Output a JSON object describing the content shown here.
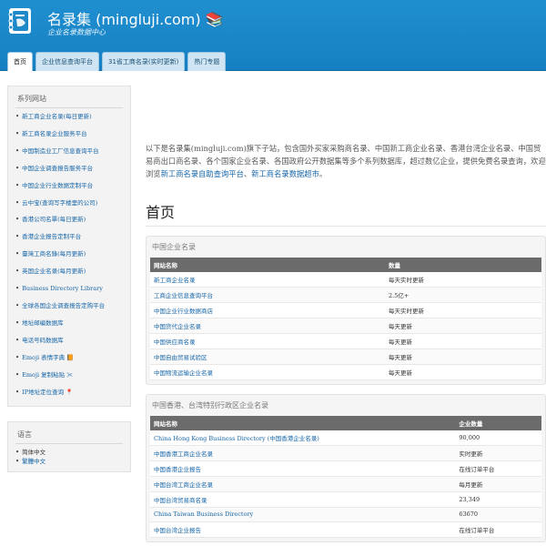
{
  "header": {
    "title": "名录集 (mingluji.com) 📚",
    "subtitle": "企业名录数据中心"
  },
  "nav": {
    "tabs": [
      {
        "label": "首页",
        "active": true
      },
      {
        "label": "企业信息查询平台",
        "active": false
      },
      {
        "label": "31省工商名录(实时更新)",
        "active": false
      },
      {
        "label": "热门专题",
        "active": false
      }
    ]
  },
  "sidebar": {
    "series_title": "系列网站",
    "series_items": [
      "新工商企业名录(每日更新)",
      "新工商名录企业服务平台",
      "中国制造业工厂信息查询平台",
      "中国企业调查报告服务平台",
      "中国企业行业数据定制平台",
      "云中宝(查询写字楼里的公司)",
      "香港公司名單(每日更新)",
      "香港企业报告定制平台",
      "臺灣工商名錄(每月更新)",
      "英国企业名录(每月更新)",
      "Business Directory Library",
      "全球各国企业调查报告定购平台",
      "地址邮编数据库",
      "电话号码数据库",
      "Emoji 表情字典 📙",
      "Emoji 复制粘贴 ✂",
      "IP地址定位查询 📍"
    ],
    "language_title": "语言",
    "languages": [
      {
        "label": "简体中文",
        "link": false
      },
      {
        "label": "繁體中文",
        "link": true
      }
    ]
  },
  "main": {
    "intro_text": "以下是名录集(mingluji.com)旗下子站，包含国外买家采购商名录、中国新工商企业名录、香港台湾企业名录、中国贸易商出口商名录、各个国家企业名录、各国政府公开数据集等多个系列数据库，超过数亿企业，提供免费名录查询，欢迎浏览",
    "intro_link1": "新工商名录自助查询平台",
    "intro_sep": "、",
    "intro_link2": "新工商名录数据超市",
    "intro_end": "。",
    "page_title": "首页",
    "panels": [
      {
        "title": "中国企业名录",
        "col1": "网站名称",
        "col2": "数量",
        "rows": [
          {
            "name": "新工商企业名录",
            "value": "每天实时更新"
          },
          {
            "name": "工商企业信息查询平台",
            "value": "2.5亿+"
          },
          {
            "name": "中国企业行业数据商店",
            "value": "每天实时更新"
          },
          {
            "name": "中国货代企业名录",
            "value": "每天更新"
          },
          {
            "name": "中国供应商名录",
            "value": "每天更新"
          },
          {
            "name": "中国自由贸易试验区",
            "value": "每天更新"
          },
          {
            "name": "中国物流运输企业名录",
            "value": "每天更新"
          }
        ]
      },
      {
        "title": "中国香港、台湾特别行政区企业名录",
        "col1": "网站名称",
        "col2": "企业数量",
        "rows": [
          {
            "name": "China Hong Kong Business Directory (中国香港企业名录)",
            "value": "90,000"
          },
          {
            "name": "中国香港工商企业名录",
            "value": "实时更新"
          },
          {
            "name": "中国香港企业报告",
            "value": "在线订单平台"
          },
          {
            "name": "中国台湾工商企业名录",
            "value": "每月更新"
          },
          {
            "name": "中国台湾贸易商名录",
            "value": "23,349"
          },
          {
            "name": "China Taiwan Business Directory",
            "value": "63670"
          },
          {
            "name": "中国台湾企业报告",
            "value": "在线订单平台"
          }
        ]
      }
    ]
  }
}
